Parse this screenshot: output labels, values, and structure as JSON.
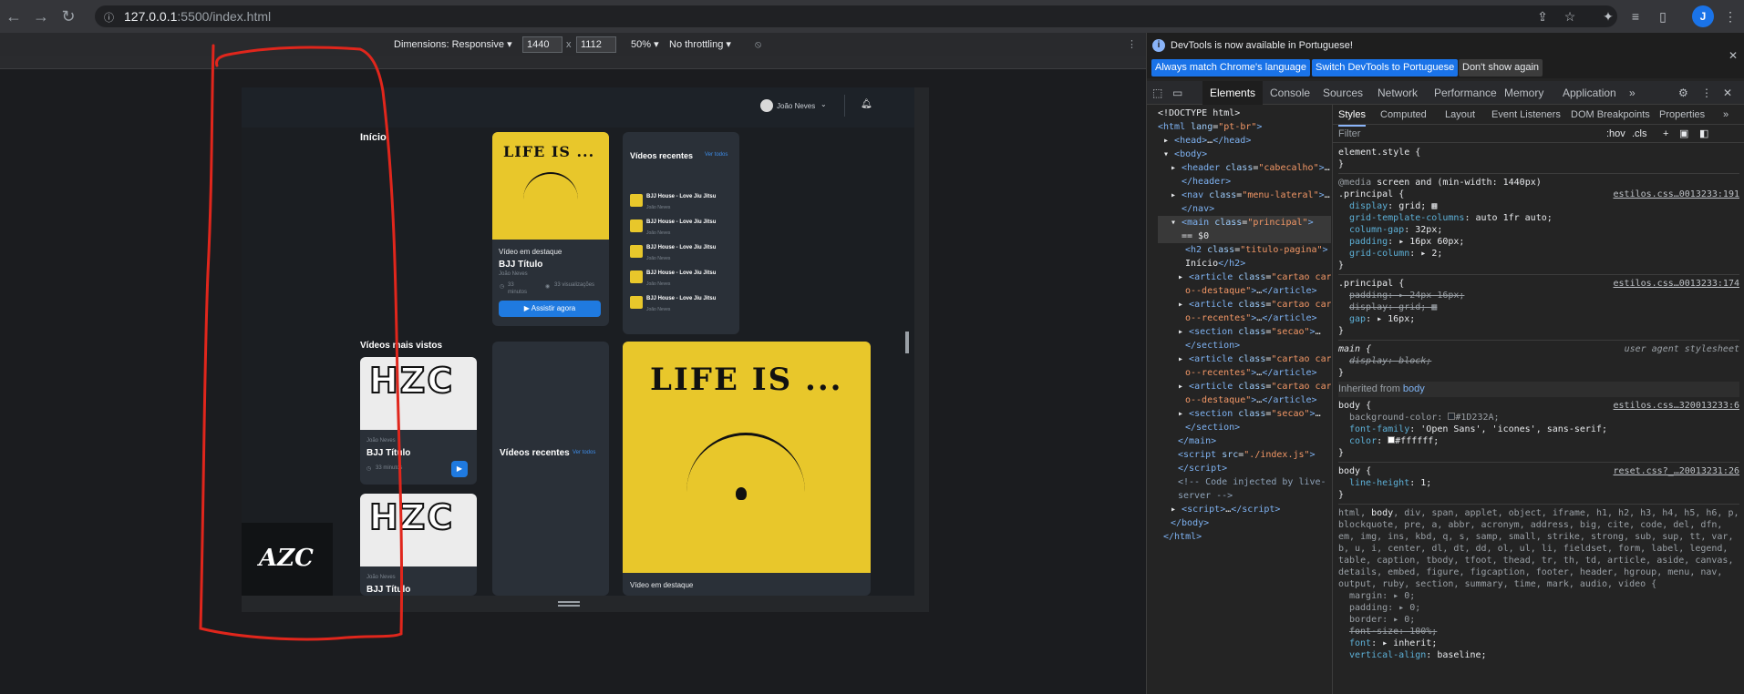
{
  "browser": {
    "url_host": "127.0.0.1",
    "url_rest": ":5500/index.html",
    "profile_initial": "J"
  },
  "device_toolbar": {
    "dimensions": "Dimensions: Responsive",
    "width": "1440",
    "times": "x",
    "height": "1112",
    "zoom": "50%",
    "throttling": "No throttling"
  },
  "site": {
    "user_name": "João Neves",
    "page_title": "Início",
    "featured": {
      "label": "Vídeo em destaque",
      "title": "BJJ Título",
      "author": "João Neves",
      "duration": "33 minutos",
      "views": "33 visualizações",
      "cta": "Assistir agora",
      "thumb_text": "LIFE IS ..."
    },
    "recent": {
      "title": "Vídeos recentes",
      "see_all": "Ver todos",
      "items": [
        {
          "title": "BJJ House - Love Jiu Jitsu",
          "author": "João Neves"
        },
        {
          "title": "BJJ House - Love Jiu Jitsu",
          "author": "João Neves"
        },
        {
          "title": "BJJ House - Love Jiu Jitsu",
          "author": "João Neves"
        },
        {
          "title": "BJJ House - Love Jiu Jitsu",
          "author": "João Neves"
        },
        {
          "title": "BJJ House - Love Jiu Jitsu",
          "author": "João Neves"
        }
      ]
    },
    "most_viewed": {
      "title": "Vídeos mais vistos",
      "items": [
        {
          "author": "João Neves",
          "title": "BJJ Título",
          "duration": "33 minutos",
          "thumb_text": "HZC"
        },
        {
          "author": "João Neves",
          "title": "BJJ Título",
          "thumb_text": "HZC"
        }
      ]
    },
    "recent2": {
      "title": "Vídeos recentes",
      "see_all": "Ver todos"
    },
    "featured2": {
      "label": "Vídeo em destaque",
      "thumb_text": "LIFE IS ..."
    },
    "logo_text": "AZC"
  },
  "devtools": {
    "banner_text": "DevTools is now available in Portuguese!",
    "btn_match": "Always match Chrome's language",
    "btn_switch": "Switch DevTools to Portuguese",
    "btn_dont": "Don't show again",
    "tabs": [
      "Elements",
      "Console",
      "Sources",
      "Network",
      "Performance",
      "Memory",
      "Application"
    ],
    "style_tabs": [
      "Styles",
      "Computed",
      "Layout",
      "Event Listeners",
      "DOM Breakpoints",
      "Properties"
    ],
    "filter": "Filter",
    "hov": ":hov",
    "cls": ".cls"
  },
  "colors": {
    "accent": "#1f7ae0",
    "yellow": "#e8c72b",
    "bg": "#1D232A",
    "red_annotation": "#e0261c"
  }
}
